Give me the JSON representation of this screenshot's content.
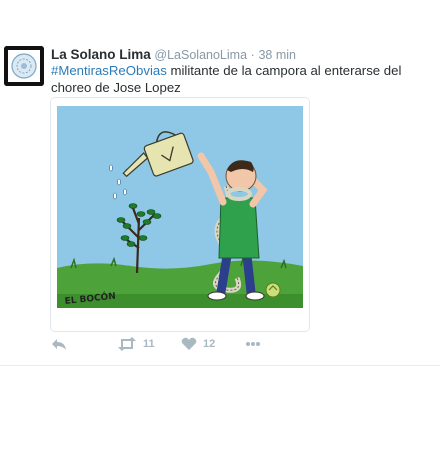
{
  "tweet": {
    "fullname": "La Solano Lima",
    "screen_name": "@LaSolanoLima",
    "separator": "·",
    "time": "38 min",
    "hashtag": "#MentirasReObvias",
    "text": " militante de la campora al enterarse del choreo de Jose Lopez",
    "media_signature": "EL BOCÓN",
    "actions": {
      "reply_icon": "reply-icon",
      "retweet_icon": "retweet-icon",
      "retweet_count": "11",
      "like_icon": "heart-icon",
      "like_count": "12",
      "more_icon": "more-icon"
    }
  },
  "colors": {
    "text": "#292f33",
    "meta": "#8899a6",
    "link": "#2b7bb9",
    "action": "#aab8c2",
    "divider": "#e6ecf0"
  }
}
